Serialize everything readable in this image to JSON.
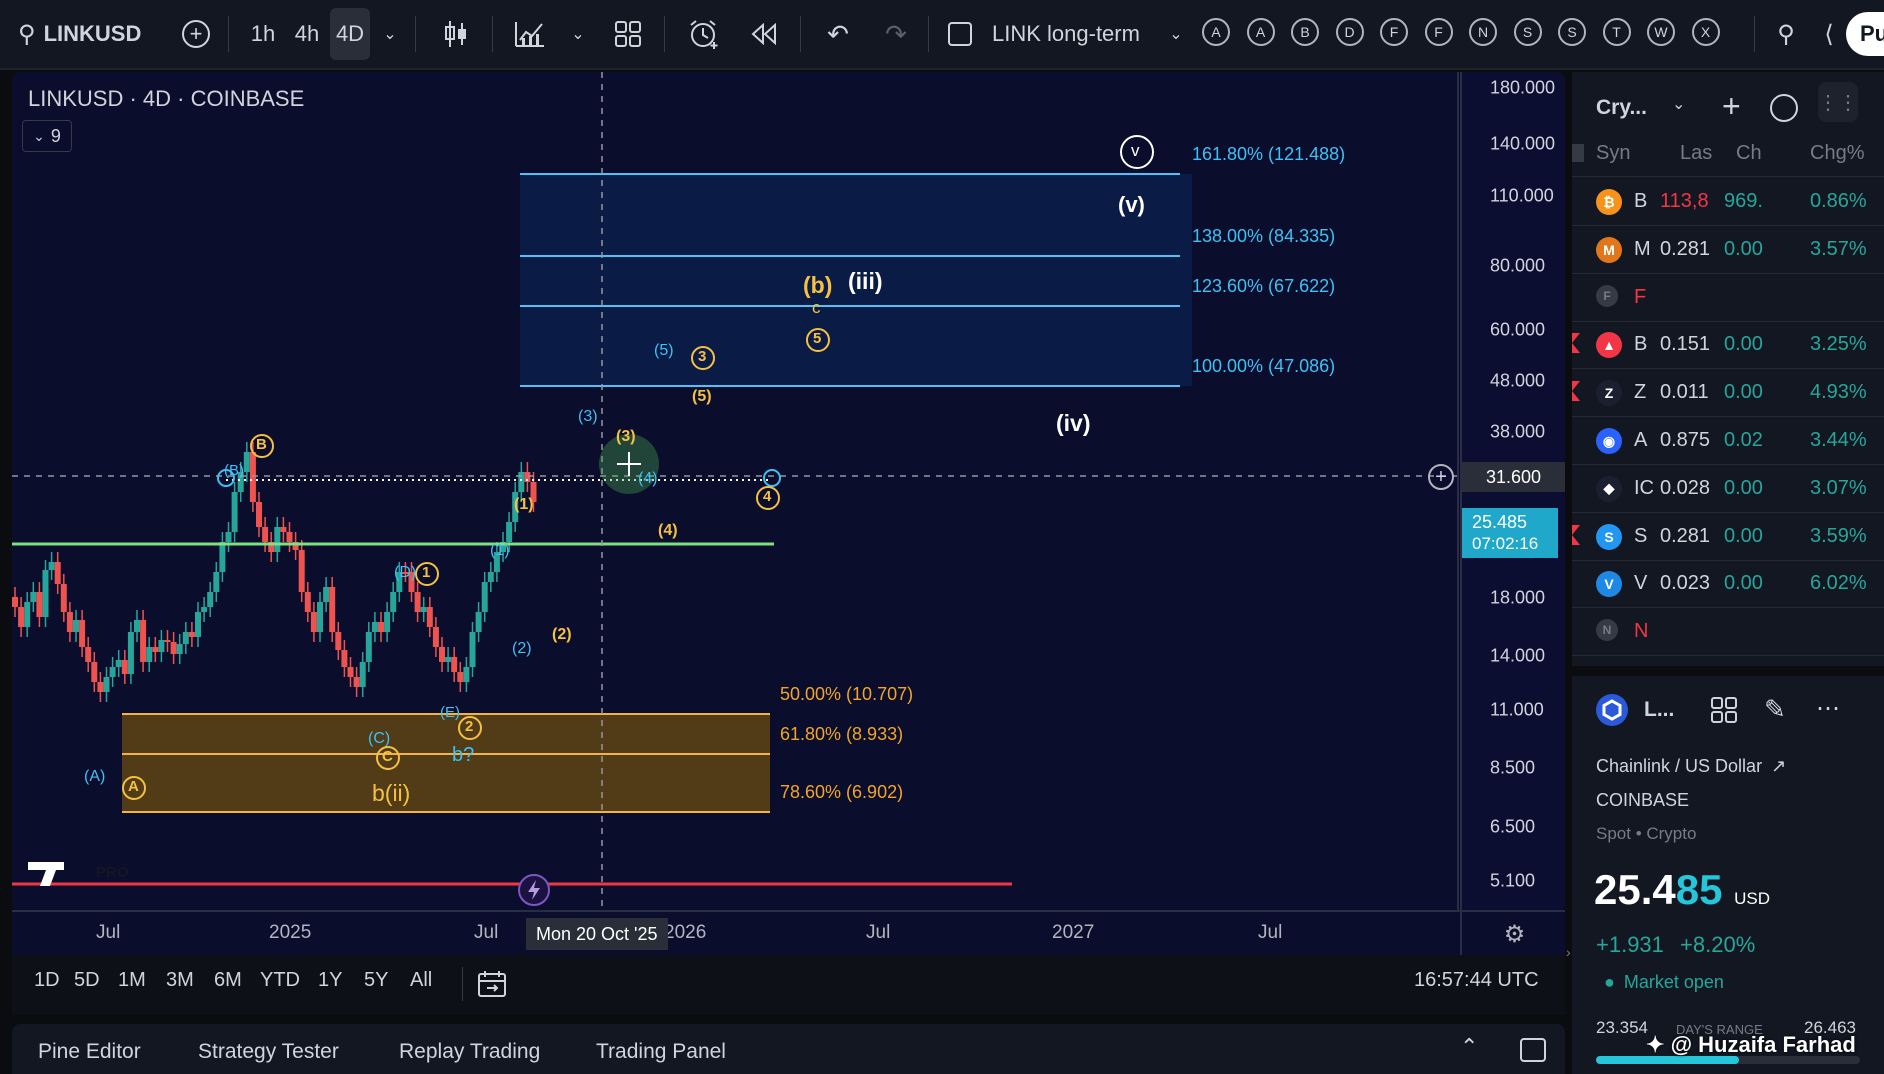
{
  "toolbar": {
    "symbol": "LINKUSD",
    "intervals": [
      "1h",
      "4h",
      "4D"
    ],
    "active_interval": "4D",
    "layout_name": "LINK long-term",
    "alert_letters": [
      "A",
      "A",
      "B",
      "D",
      "F",
      "F",
      "N",
      "S",
      "S",
      "T",
      "W",
      "X"
    ],
    "publish_label": "Pu"
  },
  "chart": {
    "title": "LINKUSD · 4D · COINBASE",
    "indicators_count": "9",
    "price_axis": [
      "180.000",
      "140.000",
      "110.000",
      "80.000",
      "60.000",
      "48.000",
      "38.000",
      "31.600",
      "18.000",
      "14.000",
      "11.000",
      "8.500",
      "6.500",
      "5.100"
    ],
    "current_price": "25.485",
    "countdown": "07:02:16",
    "crosshair_price": "31.600",
    "time_axis": [
      "Jul",
      "2025",
      "Jul",
      "2026",
      "Jul",
      "2027",
      "Jul"
    ],
    "crosshair_date": "Mon 20 Oct '25",
    "logo_text": "PRO",
    "fib_upper": [
      {
        "label": "161.80% (121.488)"
      },
      {
        "label": "138.00% (84.335)"
      },
      {
        "label": "123.60% (67.622)"
      },
      {
        "label": "100.00% (47.086)"
      }
    ],
    "fib_lower": [
      {
        "label": "50.00% (10.707)"
      },
      {
        "label": "61.80% (8.933)"
      },
      {
        "label": "78.60% (6.902)"
      }
    ],
    "wave_labels": {
      "v_circle": "v",
      "v": "(v)",
      "b": "(b)",
      "iii": "(iii)",
      "c": "c",
      "five_cyan": "(5)",
      "three_circle": "3",
      "five_circle": "5",
      "five_yel": "(5)",
      "iv": "(iv)",
      "three_cyan": "(3)",
      "three_yel": "(3)",
      "four_cyan": "(4)",
      "four_circle": "4",
      "four_yel": "(4)",
      "one_yel": "(1)",
      "one_cyan": "(1)",
      "two_yel": "(2)",
      "two_cyan": "(2)",
      "B_circle": "B",
      "B_cyan": "(B)",
      "D_cyan": "(D)",
      "one_circle": "1",
      "C_cyan": "(C)",
      "C_circle": "C",
      "E_cyan": "(E)",
      "two_circle": "2",
      "b_q": "b?",
      "bii": "b(ii)",
      "A_cyan": "(A)",
      "A_circle": "A"
    }
  },
  "range_bar": {
    "ranges": [
      "1D",
      "5D",
      "1M",
      "3M",
      "6M",
      "YTD",
      "1Y",
      "5Y",
      "All"
    ],
    "time": "16:57:44 UTC"
  },
  "bottom_tabs": [
    "Pine Editor",
    "Strategy Tester",
    "Replay Trading",
    "Trading Panel"
  ],
  "watchlist": {
    "title": "Cry...",
    "columns": [
      "Syn",
      "Las",
      "Ch",
      "Chg%"
    ],
    "rows": [
      {
        "sym": "B",
        "last": "113,8",
        "chg": "969.",
        "pct": "0.86%",
        "icon_color": "#f7931a",
        "icon_char": "₿",
        "last_color": "#f23645",
        "flag": false
      },
      {
        "sym": "M",
        "last": "0.281",
        "chg": "0.00",
        "pct": "3.57%",
        "icon_color": "#e2761b",
        "icon_char": "M",
        "last_color": "#d1d4dc",
        "flag": false
      },
      {
        "sym": "F",
        "last": "",
        "chg": "",
        "pct": "",
        "icon_color": "#363a45",
        "icon_char": "F",
        "last_color": "#d1d4dc",
        "flag": false,
        "section": true
      },
      {
        "sym": "B",
        "last": "0.151",
        "chg": "0.00",
        "pct": "3.25%",
        "icon_color": "#f23645",
        "icon_char": "▲",
        "last_color": "#d1d4dc",
        "flag": true
      },
      {
        "sym": "Z",
        "last": "0.011",
        "chg": "0.00",
        "pct": "4.93%",
        "icon_color": "#1b2030",
        "icon_char": "Z",
        "last_color": "#d1d4dc",
        "flag": true
      },
      {
        "sym": "A",
        "last": "0.875",
        "chg": "0.02",
        "pct": "3.44%",
        "icon_color": "#2962ff",
        "icon_char": "◉",
        "last_color": "#d1d4dc",
        "flag": false
      },
      {
        "sym": "IC",
        "last": "0.028",
        "chg": "0.00",
        "pct": "3.07%",
        "icon_color": "#1b2030",
        "icon_char": "◆",
        "last_color": "#d1d4dc",
        "flag": false
      },
      {
        "sym": "S",
        "last": "0.281",
        "chg": "0.00",
        "pct": "3.59%",
        "icon_color": "#2196f3",
        "icon_char": "S",
        "last_color": "#d1d4dc",
        "flag": true
      },
      {
        "sym": "V",
        "last": "0.023",
        "chg": "0.00",
        "pct": "6.02%",
        "icon_color": "#1e88e5",
        "icon_char": "V",
        "last_color": "#d1d4dc",
        "flag": false
      },
      {
        "sym": "N",
        "last": "",
        "chg": "",
        "pct": "",
        "icon_color": "#363a45",
        "icon_char": "N",
        "last_color": "#d1d4dc",
        "flag": false,
        "section": true
      }
    ]
  },
  "details": {
    "short": "L...",
    "name": "Chainlink / US Dollar",
    "exchange": "COINBASE",
    "type": "Spot • Crypto",
    "price_main": "25.4",
    "price_frac": "85",
    "currency": "USD",
    "change": "+1.931",
    "change_pct": "+8.20%",
    "status": "Market open",
    "range_low": "23.354",
    "range_label": "DAY'S RANGE",
    "range_high": "26.463",
    "watermark": "@ Huzaifa Farhad"
  },
  "colors": {
    "up": "#26a69a",
    "down": "#ef5350",
    "fib_cyan": "#4fc3f7",
    "fib_orange": "#f5b342",
    "support_green": "#7ee081",
    "accent_blue": "#2962ff"
  }
}
